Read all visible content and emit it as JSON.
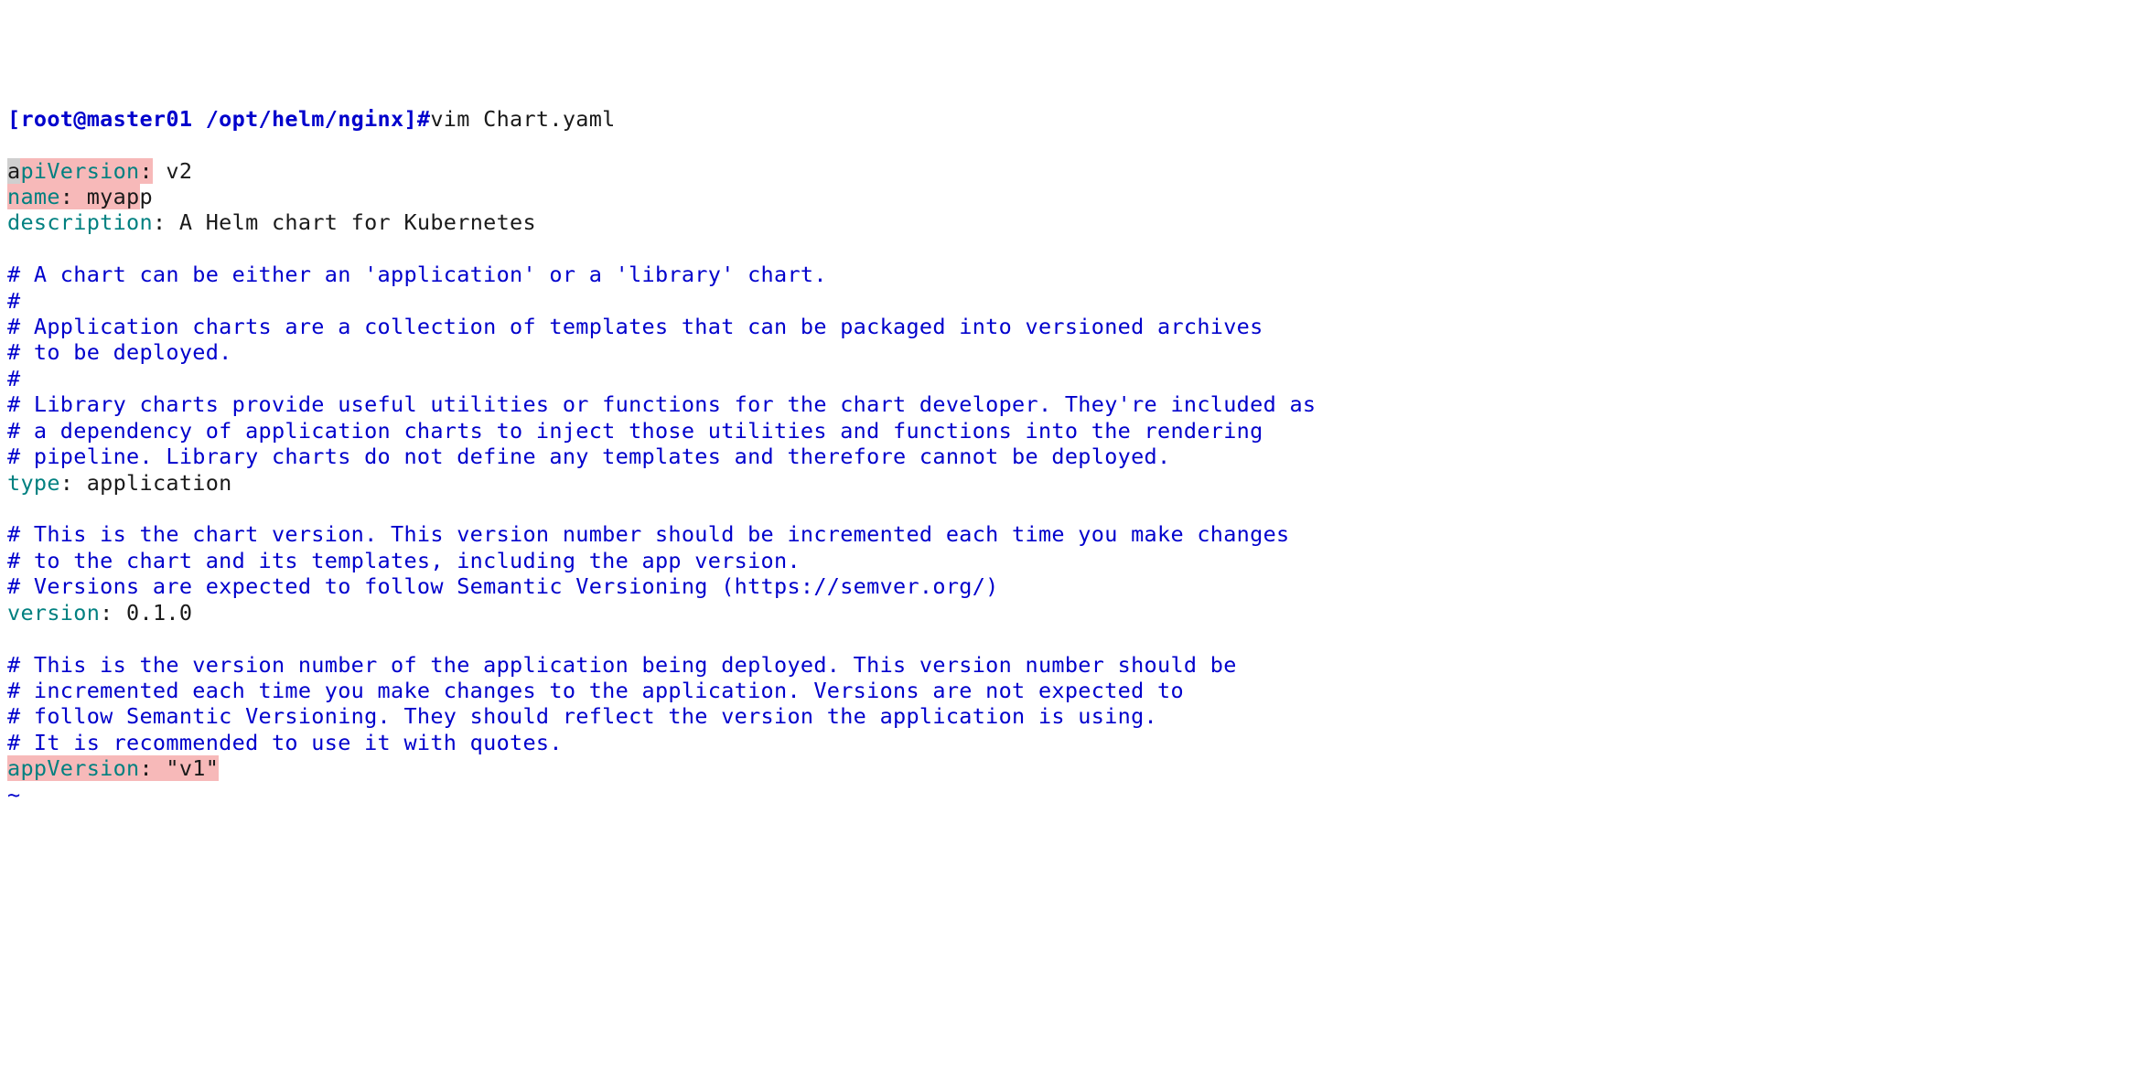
{
  "prompt": {
    "user_host_path": "[root@master01 /opt/helm/nginx]#",
    "command": "vim Chart.yaml"
  },
  "lines": {
    "apiVersion_key": "apiVersion",
    "apiVersion_colon": ":",
    "apiVersion_val": " v2",
    "name_key": "name",
    "name_colon": ":",
    "name_val_hl": " myap",
    "name_val_tail": "p",
    "description_key": "description",
    "description_colon": ":",
    "description_val": " A Helm chart for Kubernetes",
    "c1": "# A chart can be either an 'application' or a 'library' chart.",
    "c2": "#",
    "c3": "# Application charts are a collection of templates that can be packaged into versioned archives",
    "c4": "# to be deployed.",
    "c5": "#",
    "c6": "# Library charts provide useful utilities or functions for the chart developer. They're included as",
    "c7": "# a dependency of application charts to inject those utilities and functions into the rendering",
    "c8": "# pipeline. Library charts do not define any templates and therefore cannot be deployed.",
    "type_key": "type",
    "type_colon": ":",
    "type_val": " application",
    "c9": "# This is the chart version. This version number should be incremented each time you make changes",
    "c10": "# to the chart and its templates, including the app version.",
    "c11": "# Versions are expected to follow Semantic Versioning (https://semver.org/)",
    "version_key": "version",
    "version_colon": ":",
    "version_val": " 0.1.0",
    "c12": "# This is the version number of the application being deployed. This version number should be",
    "c13": "# incremented each time you make changes to the application. Versions are not expected to",
    "c14": "# follow Semantic Versioning. They should reflect the version the application is using.",
    "c15": "# It is recommended to use it with quotes.",
    "appVersion_key": "appVersion",
    "appVersion_colon": ":",
    "appVersion_val_hl": " \"v1\"",
    "tilde": "~"
  }
}
